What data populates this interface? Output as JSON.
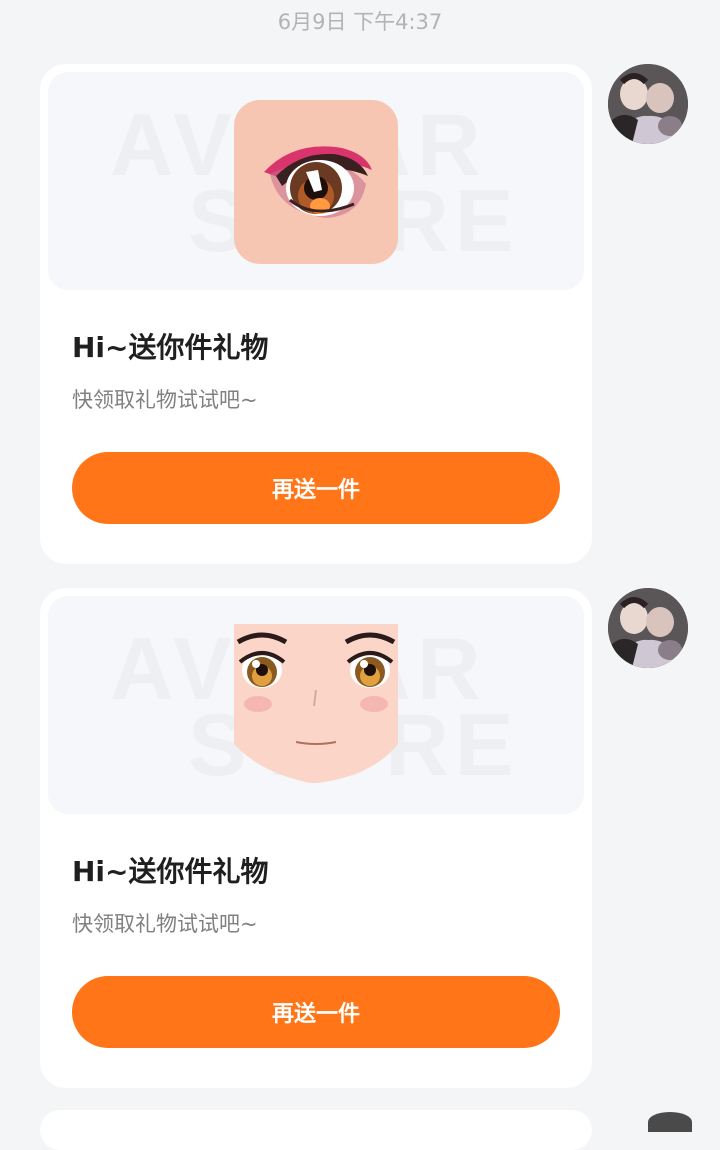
{
  "timestamp": "6月9日 下午4:37",
  "messages": [
    {
      "title": "Hi~送你件礼物",
      "subtitle": "快领取礼物试试吧~",
      "button_label": "再送一件",
      "watermark_line1": "AVATAR",
      "watermark_line2": "STORE",
      "item_icon": "eye-makeup-icon"
    },
    {
      "title": "Hi~送你件礼物",
      "subtitle": "快领取礼物试试吧~",
      "button_label": "再送一件",
      "watermark_line1": "AVATAR",
      "watermark_line2": "STORE",
      "item_icon": "face-icon"
    }
  ],
  "colors": {
    "background": "#f4f5f7",
    "accent_button": "#ff7518",
    "card": "#ffffff"
  }
}
